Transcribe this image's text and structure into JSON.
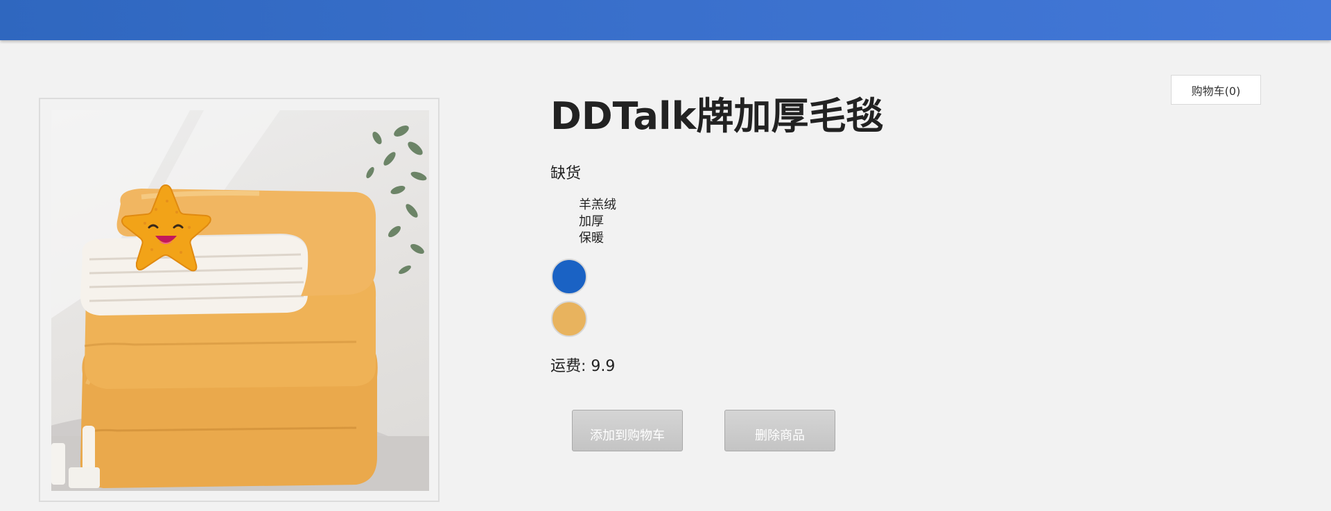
{
  "header": {
    "cart_label": "购物车(0)"
  },
  "product": {
    "title": "DDTalk牌加厚毛毯",
    "stock_status": "缺货",
    "features": [
      "羊羔绒",
      "加厚",
      "保暖"
    ],
    "colors": [
      "#1a62c4",
      "#e8b35e"
    ],
    "shipping_label": "运费:",
    "shipping_value": "9.9"
  },
  "actions": {
    "add_to_cart": "添加到购物车",
    "remove_item": "删除商品"
  },
  "icons": {
    "sticker": "smiling-star-icon"
  }
}
